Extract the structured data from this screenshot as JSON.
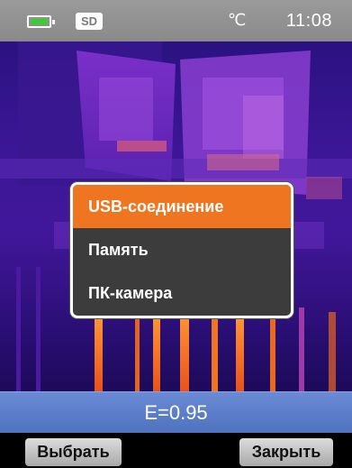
{
  "status_bar": {
    "sd_label": "SD",
    "temperature_unit": "℃",
    "time": "11:08",
    "battery_level": 1.0,
    "battery_color": "#35d12f"
  },
  "menu": {
    "items": [
      {
        "label": "USB-соединение",
        "selected": true
      },
      {
        "label": "Память",
        "selected": false
      },
      {
        "label": "ПК-камера",
        "selected": false
      }
    ],
    "highlight_color": "#f07521"
  },
  "emissivity": {
    "text": "E=0.95"
  },
  "softkeys": {
    "left_label": "Выбрать",
    "right_label": "Закрыть"
  }
}
